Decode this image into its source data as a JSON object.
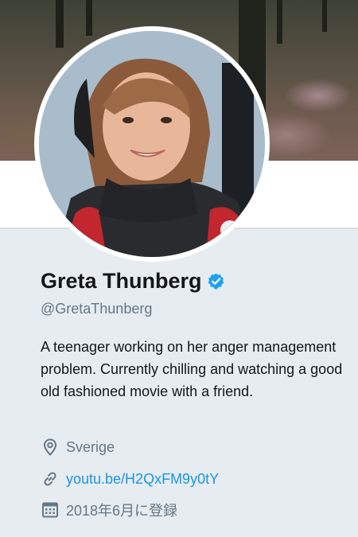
{
  "profile": {
    "name": "Greta Thunberg",
    "handle": "@GretaThunberg",
    "bio": "A teenager working on her anger management problem. Currently chilling and watching a good old fashioned movie with a friend.",
    "location": "Sverige",
    "url": "youtu.be/H2QxFM9y0tY",
    "joined": "2018年6月に登録"
  },
  "icons": {
    "verified": "verified-badge-icon",
    "location": "location-pin-icon",
    "link": "link-icon",
    "calendar": "calendar-icon"
  },
  "colors": {
    "accent": "#1b95e0",
    "verified": "#1da1f2",
    "muted": "#657786",
    "card_bg": "#e6ecf0"
  }
}
